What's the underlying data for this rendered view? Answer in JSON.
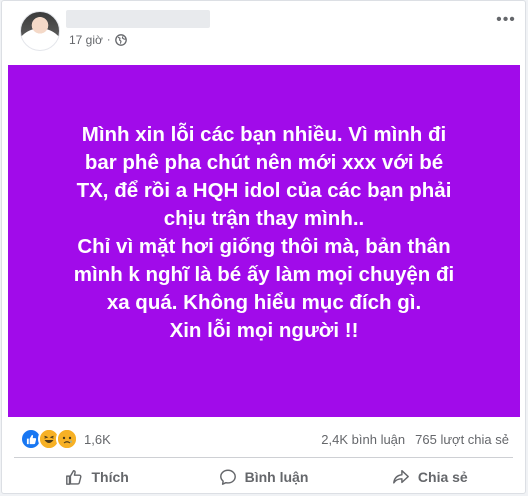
{
  "post": {
    "author_name": "",
    "time": "17 giờ",
    "privacy_icon": "globe-icon",
    "background_color": "#a10bea",
    "text": "Mình xin lỗi các bạn nhiều. Vì mình đi\nbar phê pha chút nên mới xxx với bé\nTX, để rồi a HQH idol của các bạn phải\nchịu trận thay mình..\nChỉ vì mặt hơi giống thôi mà, bản thân\nmình k nghĩ là bé ấy làm mọi chuyện đi\nxa quá. Không hiểu mục đích gì.\nXin lỗi mọi người !!"
  },
  "stats": {
    "reaction_icons": [
      "like-icon",
      "haha-icon",
      "sad-icon"
    ],
    "reaction_count": "1,6K",
    "comments": "2,4K bình luận",
    "shares": "765 lượt chia sẻ"
  },
  "actions": {
    "like_label": "Thích",
    "comment_label": "Bình luận",
    "share_label": "Chia sẻ"
  },
  "colors": {
    "accent": "#1877f2",
    "muted_text": "#65676b"
  }
}
